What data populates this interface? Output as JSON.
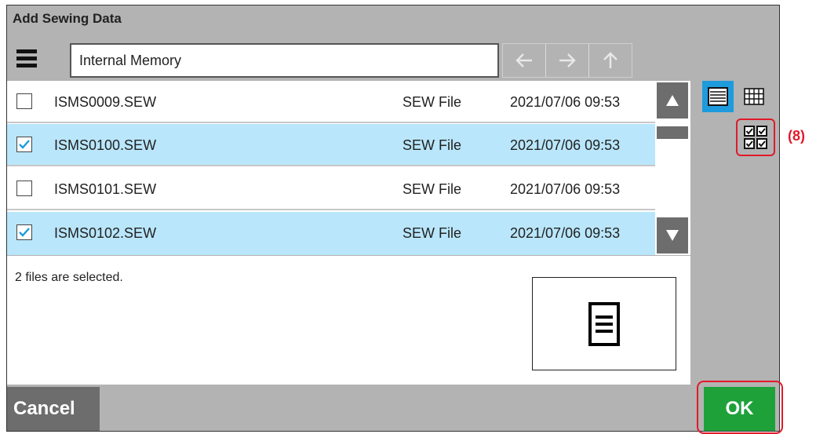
{
  "dialog": {
    "title": "Add Sewing Data"
  },
  "toolbar": {
    "path": "Internal Memory",
    "menu_icon": "menu-icon",
    "nav_icons": [
      "arrow-left-icon",
      "arrow-right-icon",
      "arrow-up-icon"
    ]
  },
  "files": [
    {
      "name": "ISMS0009.SEW",
      "type": "SEW File",
      "date": "2021/07/06 09:53",
      "checked": false
    },
    {
      "name": "ISMS0100.SEW",
      "type": "SEW File",
      "date": "2021/07/06 09:53",
      "checked": true
    },
    {
      "name": "ISMS0101.SEW",
      "type": "SEW File",
      "date": "2021/07/06 09:53",
      "checked": false
    },
    {
      "name": "ISMS0102.SEW",
      "type": "SEW File",
      "date": "2021/07/06 09:53",
      "checked": true
    }
  ],
  "status": "2 files are selected.",
  "view": {
    "list_icon": "list-view-icon",
    "grid_icon": "grid-view-icon",
    "select_all_icon": "select-all-icon"
  },
  "annotation": "(8)",
  "buttons": {
    "cancel": "Cancel",
    "ok": "OK"
  },
  "colors": {
    "selected_row": "#b9e6fb",
    "ok": "#1fa13a",
    "active_view": "#1e9bdc",
    "highlight": "#e01a2a"
  }
}
